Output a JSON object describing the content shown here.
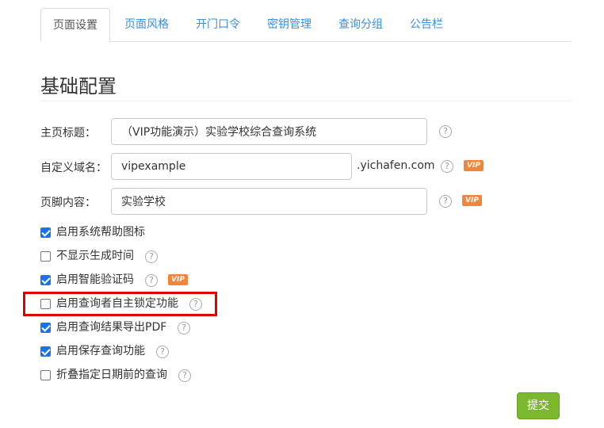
{
  "tabs": [
    {
      "label": "页面设置",
      "active": true
    },
    {
      "label": "页面风格",
      "active": false
    },
    {
      "label": "开门口令",
      "active": false
    },
    {
      "label": "密钥管理",
      "active": false
    },
    {
      "label": "查询分组",
      "active": false
    },
    {
      "label": "公告栏",
      "active": false
    }
  ],
  "section": {
    "title": "基础配置"
  },
  "fields": {
    "homepage_title": {
      "label": "主页标题：",
      "value": "（VIP功能演示）实验学校综合查询系统"
    },
    "custom_domain": {
      "label": "自定义域名：",
      "value": "vipexample",
      "suffix": ".yichafen.com",
      "vip": "VIP"
    },
    "footer": {
      "label": "页脚内容：",
      "value": "实验学校",
      "vip": "VIP"
    }
  },
  "help_icon_glyph": "?",
  "checkboxes": [
    {
      "label": "启用系统帮助图标",
      "checked": true
    },
    {
      "label": "不显示生成时间",
      "checked": false
    },
    {
      "label": "启用智能验证码",
      "checked": true,
      "vip": "VIP"
    },
    {
      "label": "启用查询者自主锁定功能",
      "checked": false
    },
    {
      "label": "启用查询结果导出PDF",
      "checked": true
    },
    {
      "label": "启用保存查询功能",
      "checked": true
    },
    {
      "label": "折叠指定日期前的查询",
      "checked": false
    }
  ],
  "submit_label": "提交",
  "colors": {
    "accent": "#1a73e8",
    "vip": "#f2853b",
    "submit": "#7cb82f",
    "highlight": "#e00000",
    "tab_link": "#3a8ee6"
  }
}
